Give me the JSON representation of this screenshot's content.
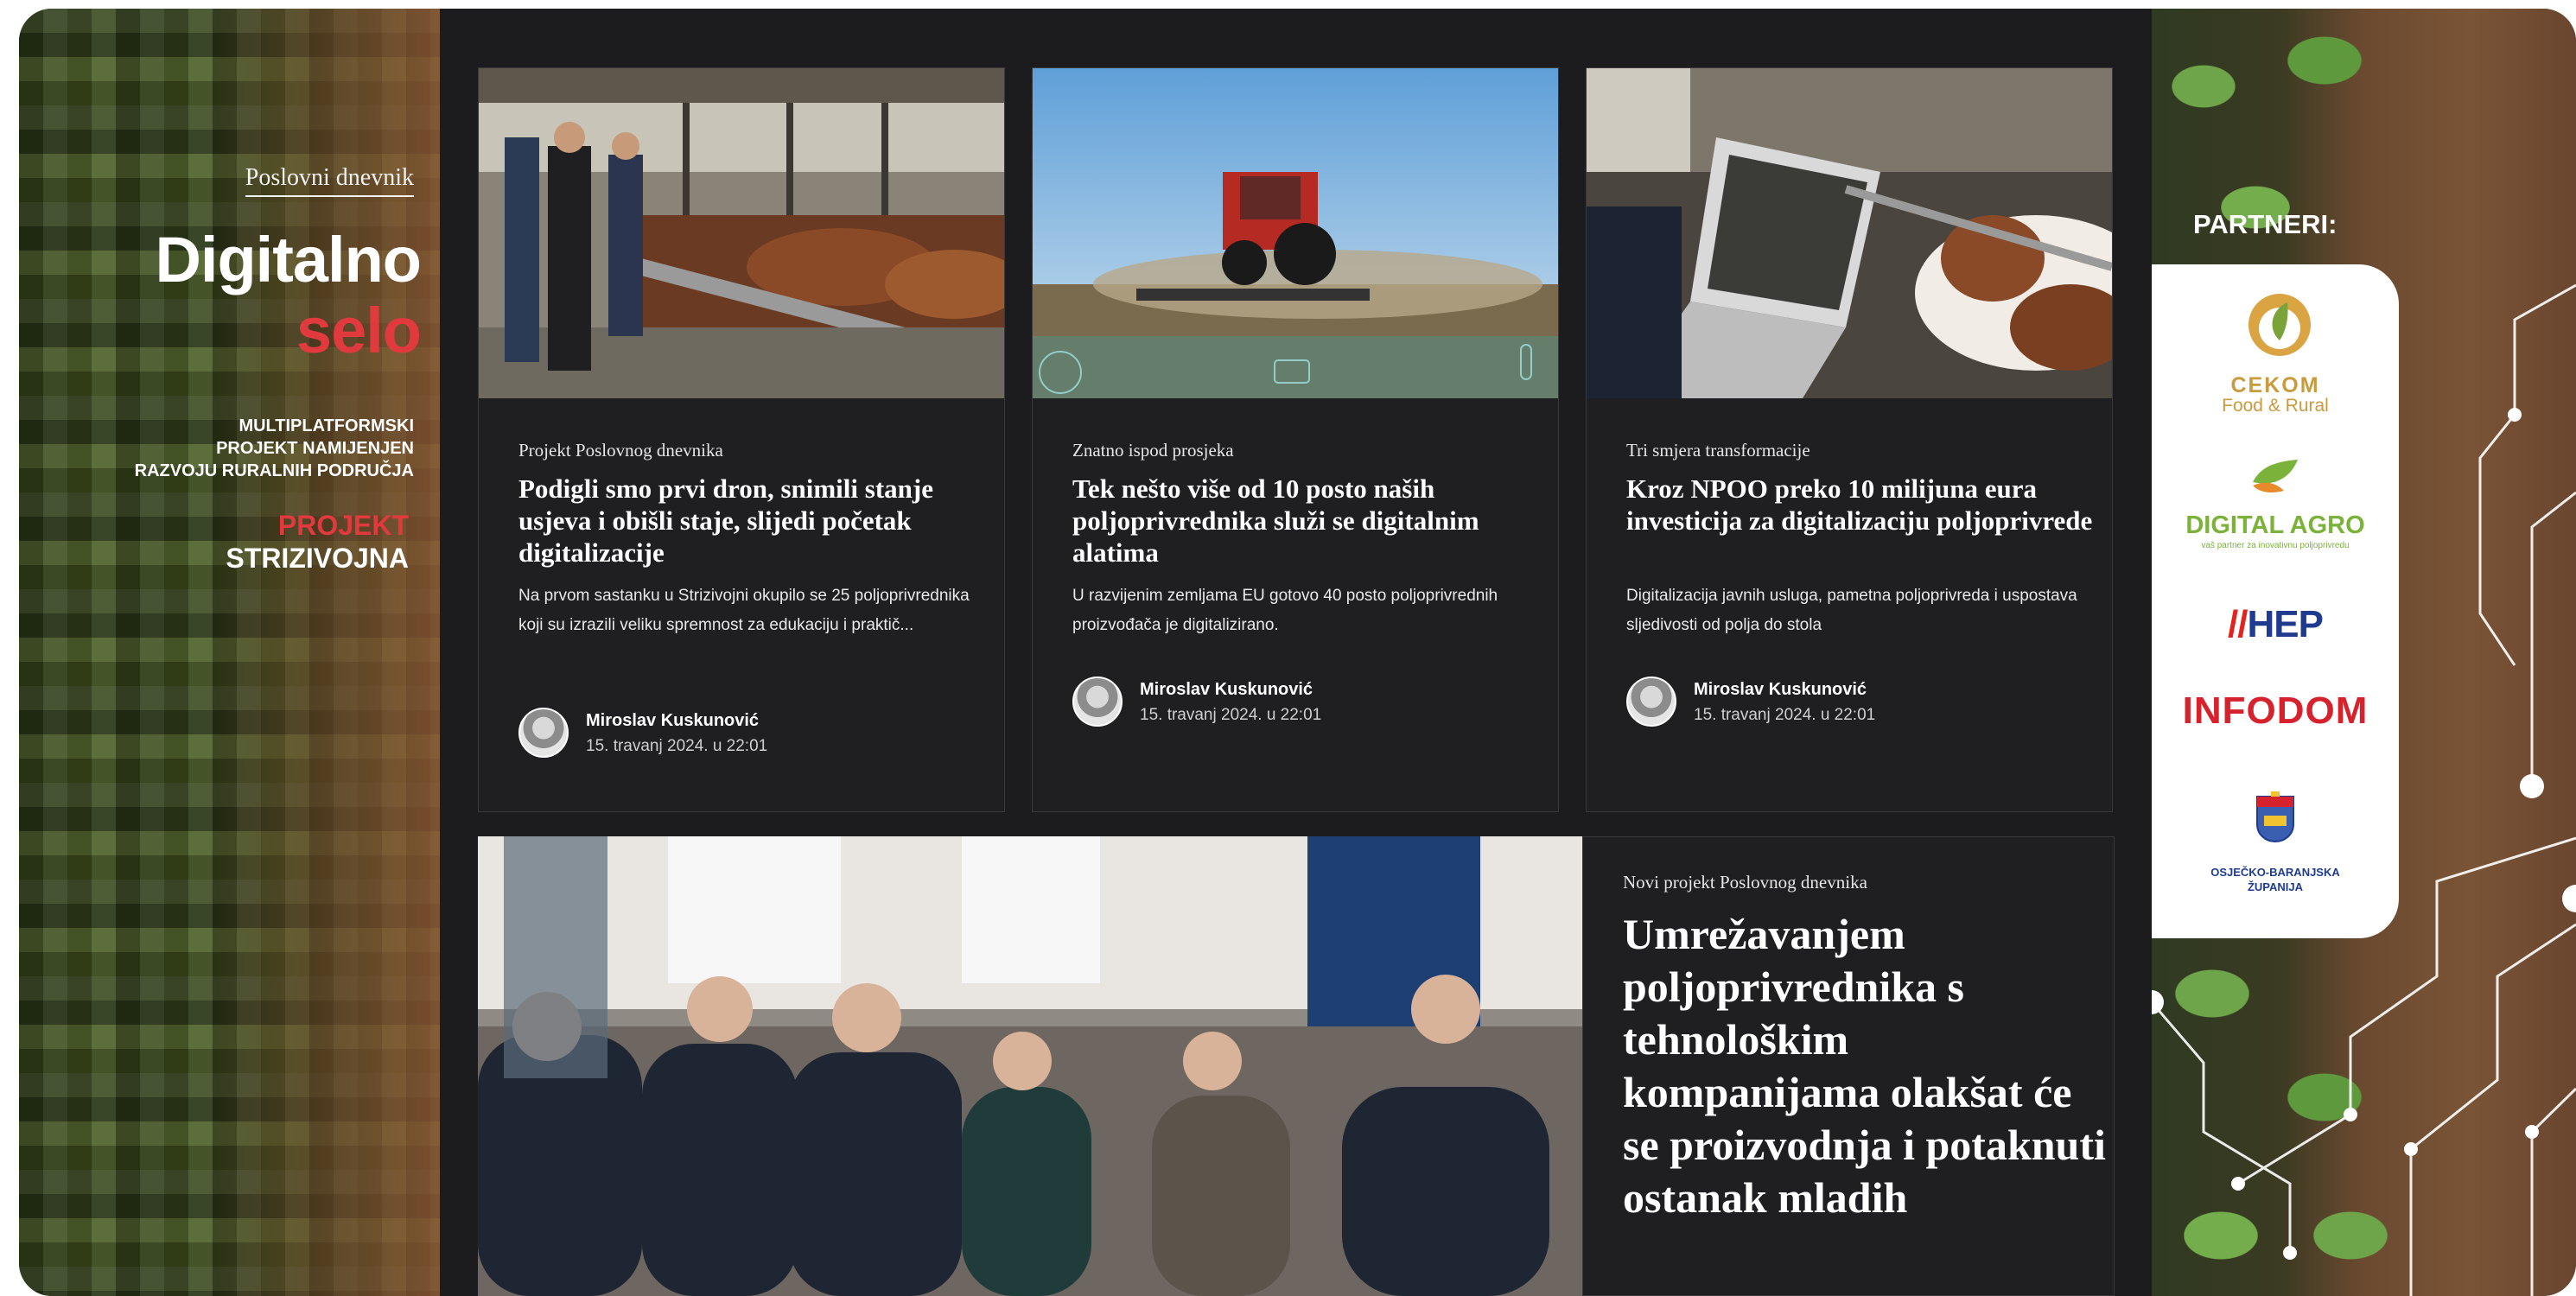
{
  "left_banner": {
    "source": "Poslovni dnevnik",
    "title_line1": "Digitalno",
    "title_line2": "selo",
    "subtitle_lines": [
      "MULTIPLATFORMSKI",
      "PROJEKT NAMIJENJEN",
      "RAZVOJU RURALNIH PODRUČJA"
    ],
    "project_label": "PROJEKT",
    "project_name": "STRIZIVOJNA",
    "colors": {
      "accent_red": "#e03a3e"
    }
  },
  "articles": [
    {
      "kicker": "Projekt Poslovnog dnevnika",
      "title": "Podigli smo prvi dron, snimili stanje usjeva i obišli staje, slijedi početak digitalizacije",
      "lede": "Na prvom sastanku u Strizivojni okupilo se 25 poljoprivrednika koji su izrazili veliku spremnost za edukaciju i praktič...",
      "author": "Miroslav Kuskunović",
      "date": "15. travanj 2024. u 22:01"
    },
    {
      "kicker": "Znatno ispod prosjeka",
      "title": "Tek nešto više od 10 posto naših poljoprivrednika služi se digitalnim alatima",
      "lede": "U razvijenim zemljama EU gotovo 40 posto poljoprivrednih proizvođača je digitalizirano.",
      "author": "Miroslav Kuskunović",
      "date": "15. travanj 2024. u 22:01"
    },
    {
      "kicker": "Tri smjera transformacije",
      "title": "Kroz NPOO preko 10 milijuna eura investicija za digitalizaciju poljoprivrede",
      "lede": "Digitalizacija javnih usluga, pametna poljoprivreda i uspostava sljedivosti od polja do stola",
      "author": "Miroslav Kuskunović",
      "date": "15. travanj 2024. u 22:01"
    }
  ],
  "featured": {
    "kicker": "Novi projekt Poslovnog dnevnika",
    "title": "Umrežavanjem poljoprivrednika s tehnološkim kompanijama olakšat će se proizvodnja i potaknuti ostanak mladih"
  },
  "partners": {
    "heading": "PARTNERI:",
    "cekom_name": "CEKOM",
    "cekom_sub": "Food & Rural",
    "digital_agro": "DIGITAL AGRO",
    "digital_agro_sub": "vaš partner za inovativnu poljoprivredu",
    "hep_slash": "//",
    "hep": "HEP",
    "infodom": "INFODOM",
    "osijek_line1": "OSJEČKO-BARANJSKA",
    "osijek_line2": "ŽUPANIJA"
  },
  "icons": [
    "ph-sensor-icon",
    "tractor-icon",
    "thermometer-icon"
  ]
}
